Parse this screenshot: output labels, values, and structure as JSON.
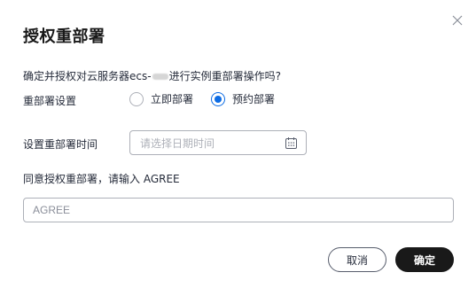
{
  "dialog": {
    "title": "授权重部署",
    "confirm_prefix": "确定并授权对云服务器ecs-",
    "confirm_suffix": "进行实例重部署操作吗?",
    "redeploy_setting_label": "重部署设置",
    "options": [
      {
        "label": "立即部署",
        "checked": false
      },
      {
        "label": "预约部署",
        "checked": true
      }
    ],
    "schedule_label": "设置重部署时间",
    "date_placeholder": "请选择日期时间",
    "agree_prompt": "同意授权重部署，请输入 AGREE",
    "agree_placeholder": "AGREE",
    "cancel_label": "取消",
    "ok_label": "确定"
  },
  "colors": {
    "accent": "#0d6ce4",
    "primary_button": "#191919",
    "border": "#adb0b8"
  },
  "icons": [
    "close-icon",
    "calendar-icon"
  ]
}
